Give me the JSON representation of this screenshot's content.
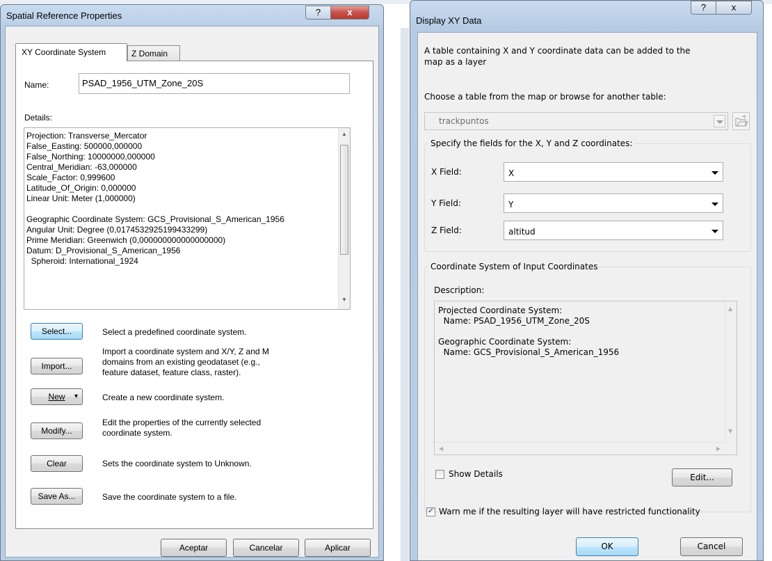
{
  "left_dialog": {
    "title": "Spatial Reference Properties",
    "help_glyph": "?",
    "close_glyph": "x",
    "tabs": [
      {
        "label": "XY Coordinate System"
      },
      {
        "label": "Z Domain"
      }
    ],
    "name_label": "Name:",
    "name_value": "PSAD_1956_UTM_Zone_20S",
    "details_label": "Details:",
    "details_text": "Projection: Transverse_Mercator\nFalse_Easting: 500000,000000\nFalse_Northing: 10000000,000000\nCentral_Meridian: -63,000000\nScale_Factor: 0,999600\nLatitude_Of_Origin: 0,000000\nLinear Unit: Meter (1,000000)\n\nGeographic Coordinate System: GCS_Provisional_S_American_1956\nAngular Unit: Degree (0,0174532925199433299)\nPrime Meridian: Greenwich (0,000000000000000000)\nDatum: D_Provisional_S_American_1956\n  Spheroid: International_1924",
    "actions": [
      {
        "label": "Select...",
        "description": "Select a predefined coordinate system."
      },
      {
        "label": "Import...",
        "description": "Import a coordinate system and X/Y, Z and M\ndomains from an existing geodataset (e.g.,\nfeature dataset, feature class, raster)."
      },
      {
        "label": "New",
        "description": "Create a new coordinate system."
      },
      {
        "label": "Modify...",
        "description": "Edit the properties of the currently selected\ncoordinate system."
      },
      {
        "label": "Clear",
        "description": "Sets the coordinate system to Unknown."
      },
      {
        "label": "Save As...",
        "description": "Save the coordinate system to a file."
      }
    ],
    "new_dropdown_glyph": "▾",
    "footer": {
      "ok": "Aceptar",
      "cancel": "Cancelar",
      "apply": "Aplicar"
    }
  },
  "right_dialog": {
    "title": "Display XY Data",
    "help_glyph": "?",
    "close_glyph": "x",
    "intro": "A table containing X and Y coordinate data can be added to the\nmap as a layer",
    "choose_label": "Choose a table from the map or browse for another table:",
    "table_value": "trackpuntos",
    "fields_group_title": "Specify the fields for the X, Y and Z coordinates:",
    "fields": [
      {
        "label": "X Field:",
        "value": "X"
      },
      {
        "label": "Y Field:",
        "value": "Y"
      },
      {
        "label": "Z Field:",
        "value": "altitud"
      }
    ],
    "coord_group_title": "Coordinate System of Input Coordinates",
    "description_label": "Description:",
    "description_text": "Projected Coordinate System:\n  Name: PSAD_1956_UTM_Zone_20S\n\nGeographic Coordinate System:\n  Name: GCS_Provisional_S_American_1956",
    "show_details_label": "Show Details",
    "show_details_checked": false,
    "edit_label": "Edit...",
    "warn_label": "Warn me if the resulting layer will have restricted functionality",
    "warn_checked": true,
    "check_glyph": "✓",
    "ok_label": "OK",
    "cancel_label": "Cancel"
  },
  "colors": {
    "frame": "#b9cde5",
    "client": "#f0f0f0",
    "close_button": "#c75050",
    "focus_button": "#bee6fd"
  }
}
